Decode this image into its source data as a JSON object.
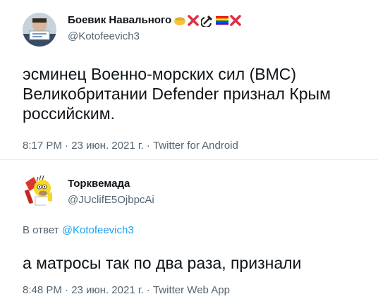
{
  "tweet1": {
    "display_name": "Боевик Навального",
    "handle": "@Kotofeevich3",
    "emoji_icons": [
      "raised-fist-icon",
      "cross-mark-icon",
      "hammer-sickle-icon",
      "rainbow-flag-icon",
      "cross-mark-icon"
    ],
    "text": "эсминец Военно-морских сил (ВМС) Великобритании Defender признал Крым российским.",
    "meta": "8:17 PM · 23 июн. 2021 г. · Twitter for Android"
  },
  "tweet2": {
    "display_name": "Торквемада",
    "handle": "@JUclifE5OjbpcAi",
    "reply_prefix": "В ответ",
    "reply_mention": "@Kotofeevich3",
    "text": "а матросы так по два раза, признали",
    "meta": "8:48 PM · 23 июн. 2021 г. · Twitter Web App"
  },
  "colors": {
    "text": "#0f1419",
    "secondary": "#536471",
    "link": "#1da1f2",
    "divider": "#e6ecf0"
  }
}
